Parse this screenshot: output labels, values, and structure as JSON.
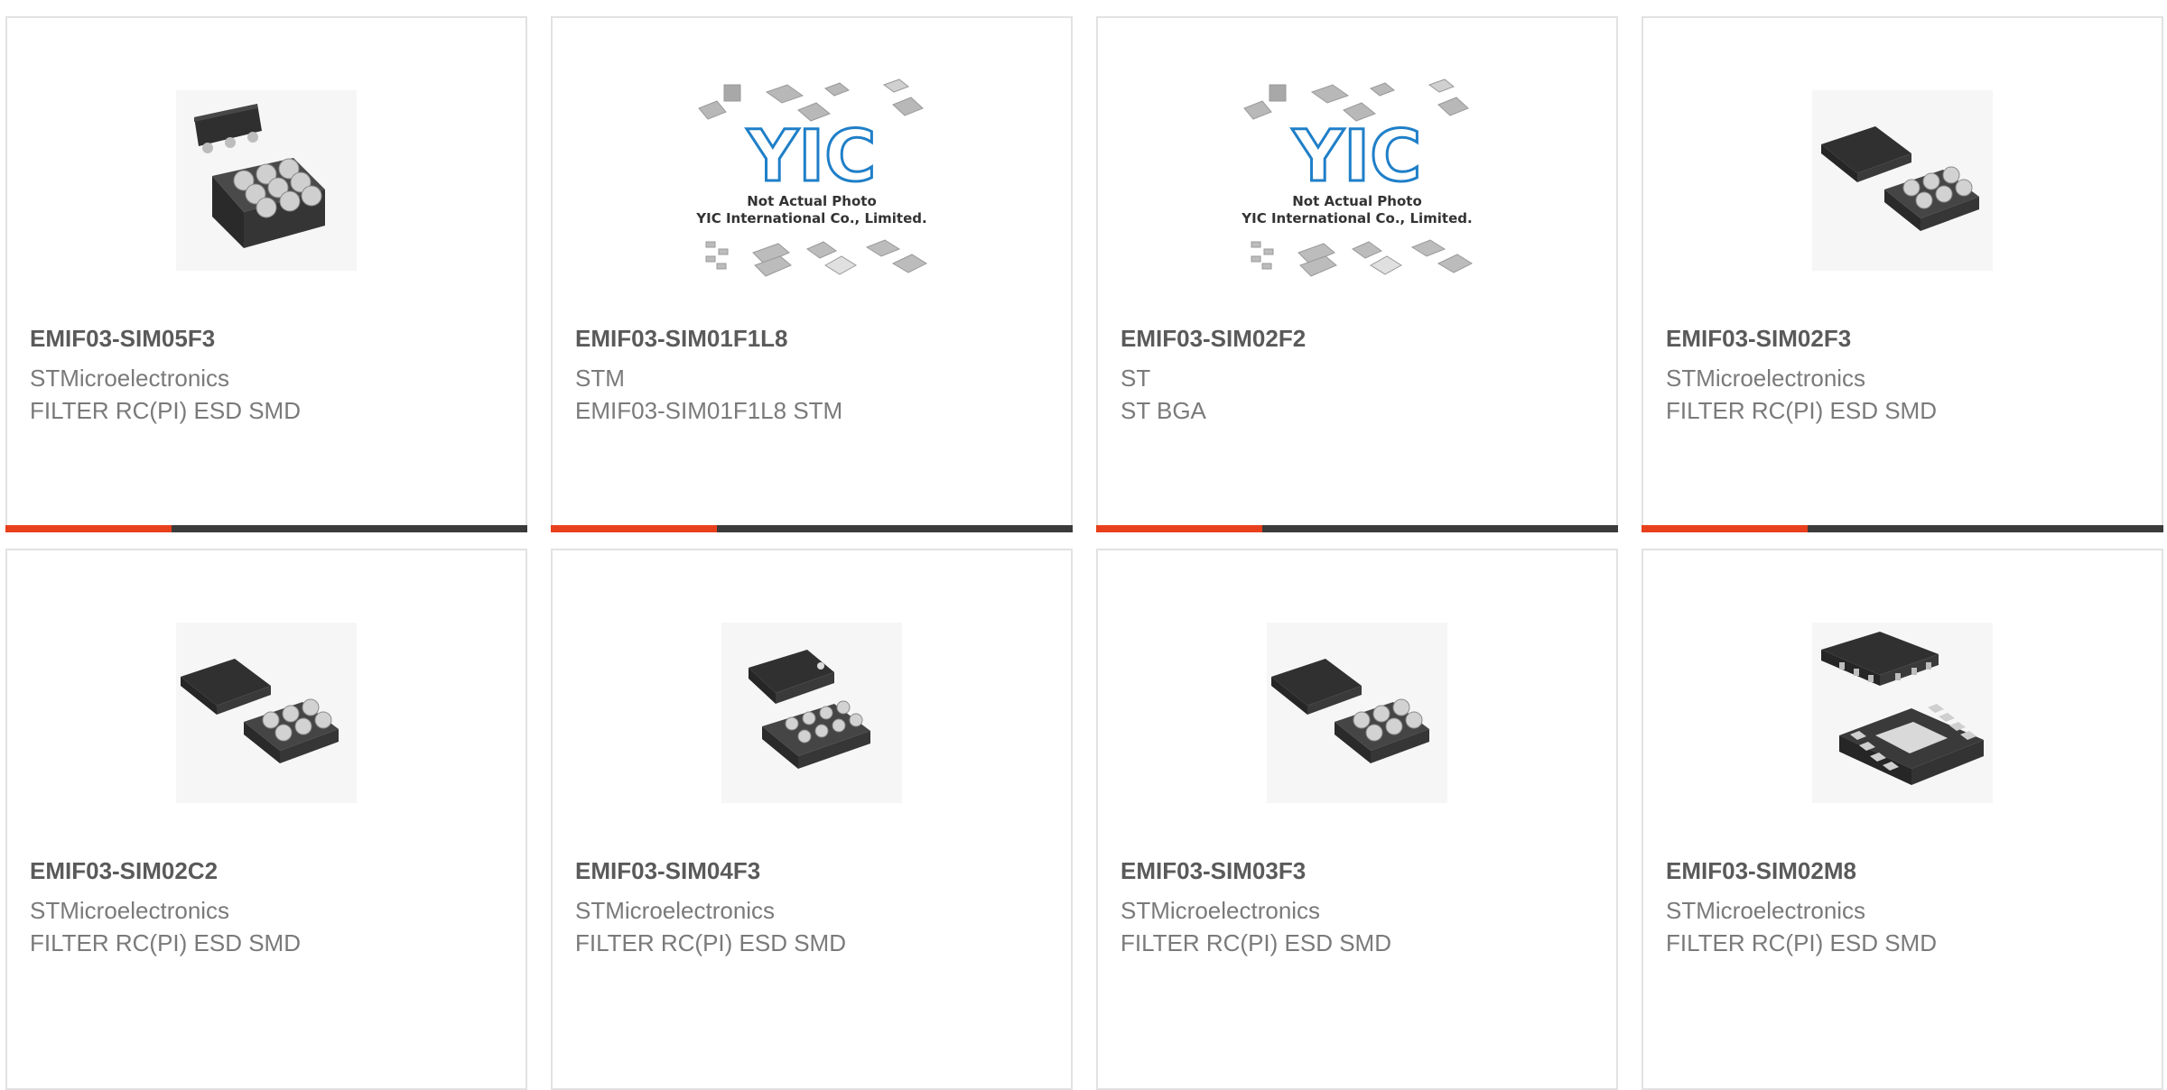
{
  "products": [
    {
      "part": "EMIF03-SIM05F3",
      "maker": "STMicroelectronics",
      "description": "FILTER RC(PI) ESD SMD",
      "image": "bga-chip-image"
    },
    {
      "part": "EMIF03-SIM01F1L8",
      "maker": "STM",
      "description": "EMIF03-SIM01F1L8 STM",
      "image": "not-actual-photo-image"
    },
    {
      "part": "EMIF03-SIM02F2",
      "maker": "ST",
      "description": "ST BGA",
      "image": "not-actual-photo-image"
    },
    {
      "part": "EMIF03-SIM02F3",
      "maker": "STMicroelectronics",
      "description": "FILTER RC(PI) ESD SMD",
      "image": "bga-chip-image"
    },
    {
      "part": "EMIF03-SIM02C2",
      "maker": "STMicroelectronics",
      "description": "FILTER RC(PI) ESD SMD",
      "image": "bga-chip-image"
    },
    {
      "part": "EMIF03-SIM04F3",
      "maker": "STMicroelectronics",
      "description": "FILTER RC(PI) ESD SMD",
      "image": "bga-chip-image"
    },
    {
      "part": "EMIF03-SIM03F3",
      "maker": "STMicroelectronics",
      "description": "FILTER RC(PI) ESD SMD",
      "image": "bga-chip-image"
    },
    {
      "part": "EMIF03-SIM02M8",
      "maker": "STMicroelectronics",
      "description": "FILTER RC(PI) ESD SMD",
      "image": "dfn-chip-image"
    }
  ],
  "placeholder_image": {
    "logo_text": "YIC",
    "caption_line1": "Not Actual Photo",
    "caption_line2": "YIC International Co., Limited."
  },
  "colors": {
    "accent": "#e8401c",
    "bar": "#3b3b3b",
    "logo_blue": "#1f7fc8",
    "chip": "#3a3a3a"
  }
}
